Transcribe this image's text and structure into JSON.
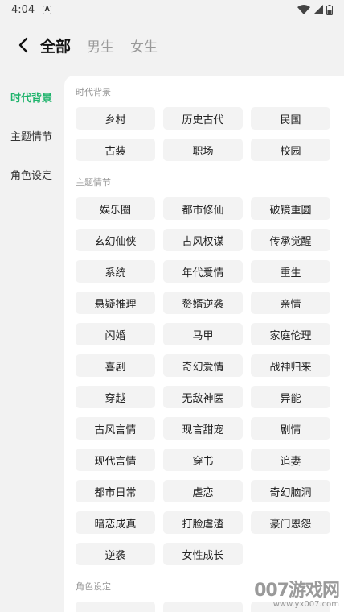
{
  "status_bar": {
    "time": "4:04",
    "notification_icon": "a-box-icon"
  },
  "header": {
    "back_icon": "chevron-left-icon",
    "tabs": [
      {
        "label": "全部",
        "active": true
      },
      {
        "label": "男生",
        "active": false
      },
      {
        "label": "女生",
        "active": false
      }
    ]
  },
  "sidebar": {
    "items": [
      {
        "label": "时代背景",
        "active": true
      },
      {
        "label": "主题情节",
        "active": false
      },
      {
        "label": "角色设定",
        "active": false
      }
    ]
  },
  "sections": [
    {
      "title": "时代背景",
      "tags": [
        "乡村",
        "历史古代",
        "民国",
        "古装",
        "职场",
        "校园"
      ]
    },
    {
      "title": "主题情节",
      "tags": [
        "娱乐圈",
        "都市修仙",
        "破镜重圆",
        "玄幻仙侠",
        "古风权谋",
        "传承觉醒",
        "系统",
        "年代爱情",
        "重生",
        "悬疑推理",
        "赘婿逆袭",
        "亲情",
        "闪婚",
        "马甲",
        "家庭伦理",
        "喜剧",
        "奇幻爱情",
        "战神归来",
        "穿越",
        "无敌神医",
        "异能",
        "古风言情",
        "现言甜宠",
        "剧情",
        "现代言情",
        "穿书",
        "追妻",
        "都市日常",
        "虐恋",
        "奇幻脑洞",
        "暗恋成真",
        "打脸虐渣",
        "豪门恩怨",
        "逆袭",
        "女性成长"
      ]
    },
    {
      "title": "角色设定",
      "tags": [
        "",
        "",
        ""
      ]
    }
  ],
  "watermark": {
    "main": "007游戏网",
    "url": "www.yx007.com"
  },
  "colors": {
    "accent": "#1db36b",
    "chip_bg": "#f3f3f3",
    "page_bg": "#f2f2f2"
  }
}
